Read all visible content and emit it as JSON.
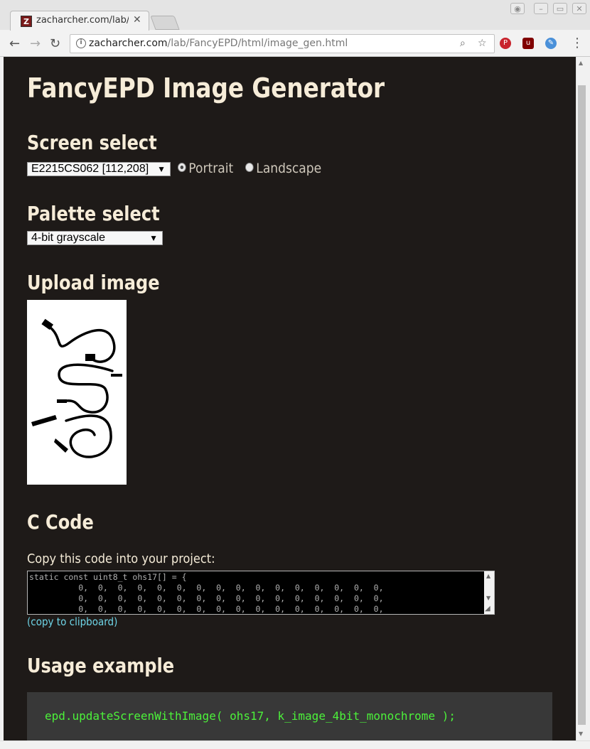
{
  "browser": {
    "tab_title": "zacharcher.com/lab/",
    "tab_favicon": "Z",
    "url_host": "zacharcher.com",
    "url_path": "/lab/FancyEPD/html/image_gen.html"
  },
  "page": {
    "title": "FancyEPD Image Generator",
    "screen_heading": "Screen select",
    "screen_select_value": "E2215CS062 [112,208]",
    "orientation_portrait": "Portrait",
    "orientation_landscape": "Landscape",
    "orientation_selected": "Portrait",
    "palette_heading": "Palette select",
    "palette_select_value": "4-bit grayscale",
    "upload_heading": "Upload image",
    "ccode_heading": "C Code",
    "copy_label": "Copy this code into your project:",
    "code_text": "static const uint8_t ohs17[] = {\n          0,  0,  0,  0,  0,  0,  0,  0,  0,  0,  0,  0,  0,  0,  0,  0,\n          0,  0,  0,  0,  0,  0,  0,  0,  0,  0,  0,  0,  0,  0,  0,  0,\n          0,  0,  0,  0,  0,  0,  0,  0,  0,  0,  0,  0,  0,  0,  0,  0,",
    "copy_link": "(copy to clipboard)",
    "usage_heading": "Usage example",
    "usage_code": "epd.updateScreenWithImage( ohs17, k_image_4bit_monochrome );"
  },
  "colors": {
    "page_bg": "#1e1a18",
    "heading": "#f6ecd8",
    "link": "#6ed4e6",
    "code_green": "#4cf23a"
  }
}
